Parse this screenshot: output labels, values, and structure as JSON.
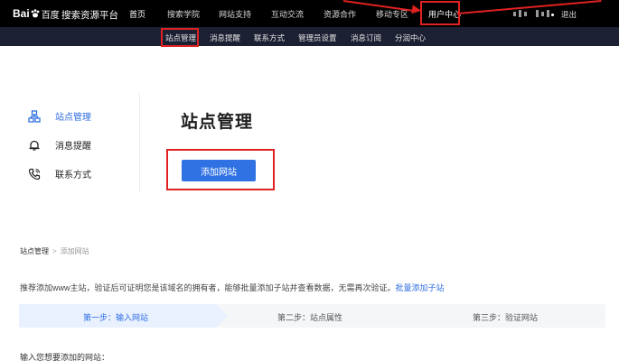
{
  "topnav": {
    "logo_text": "Bai",
    "logo_cn": "百度",
    "platform": "搜索资源平台",
    "items": [
      {
        "label": "首页"
      },
      {
        "label": "搜索学院"
      },
      {
        "label": "网站支持"
      },
      {
        "label": "互动交流"
      },
      {
        "label": "资源合作"
      },
      {
        "label": "移动专区"
      },
      {
        "label": "用户中心"
      }
    ],
    "logout": "退出"
  },
  "subnav": {
    "items": [
      {
        "label": "站点管理"
      },
      {
        "label": "消息提醒"
      },
      {
        "label": "联系方式"
      },
      {
        "label": "管理员设置"
      },
      {
        "label": "消息订阅"
      },
      {
        "label": "分润中心"
      }
    ]
  },
  "sidebar": {
    "items": [
      {
        "label": "站点管理",
        "icon": "sitemap-icon",
        "active": true
      },
      {
        "label": "消息提醒",
        "icon": "bell-icon",
        "active": false
      },
      {
        "label": "联系方式",
        "icon": "phone-icon",
        "active": false
      }
    ]
  },
  "main": {
    "title": "站点管理",
    "add_button": "添加网站"
  },
  "lower": {
    "breadcrumb": {
      "root": "站点管理",
      "sep": ">",
      "current": "添加网站"
    },
    "hint": "推荐添加www主站，验证后可证明您是该域名的拥有者，能够批量添加子站并查看数据，无需再次验证。",
    "hint_link": "批量添加子站",
    "steps": [
      {
        "label": "第一步：输入网站",
        "active": true
      },
      {
        "label": "第二步：站点属性",
        "active": false
      },
      {
        "label": "第三步：验证网站",
        "active": false
      }
    ],
    "input_label": "输入您想要添加的网站："
  },
  "colors": {
    "accent": "#3072e3",
    "annotation": "#e02121",
    "topbar": "#000000",
    "subbar": "#1c2033"
  }
}
